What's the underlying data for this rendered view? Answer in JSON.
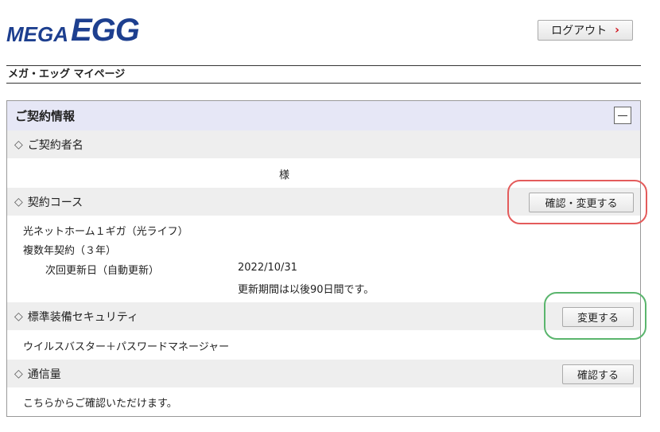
{
  "header": {
    "logo_mega": "MEGA",
    "logo_egg": "EGG",
    "logout_label": "ログアウト",
    "logout_arrow": "›"
  },
  "breadcrumb": {
    "title": "メガ・エッグ マイページ"
  },
  "panel": {
    "title": "ご契約情報",
    "sections": {
      "contractor": {
        "label": "ご契約者名",
        "name_suffix": "様"
      },
      "course": {
        "label": "契約コース",
        "button": "確認・変更する",
        "plan": "光ネットホーム１ギガ（光ライフ）",
        "term": "複数年契約（３年）",
        "renewal_label": "次回更新日（自動更新）",
        "renewal_date": "2022/10/31",
        "renewal_note": "更新期間は以後90日間です。"
      },
      "security": {
        "label": "標準装備セキュリティ",
        "button": "変更する",
        "value": "ウイルスバスター＋パスワードマネージャー"
      },
      "traffic": {
        "label": "通信量",
        "button": "確認する",
        "value": "こちらからご確認いただけます。"
      }
    }
  },
  "icons": {
    "diamond": "◇"
  },
  "colors": {
    "brand": "#1d3f8f",
    "header_bg": "#e6e7f6",
    "section_bg": "#eeeeee",
    "highlight_red": "#e45b5b",
    "highlight_green": "#5ab56d",
    "logout_arrow": "#d0101a"
  }
}
